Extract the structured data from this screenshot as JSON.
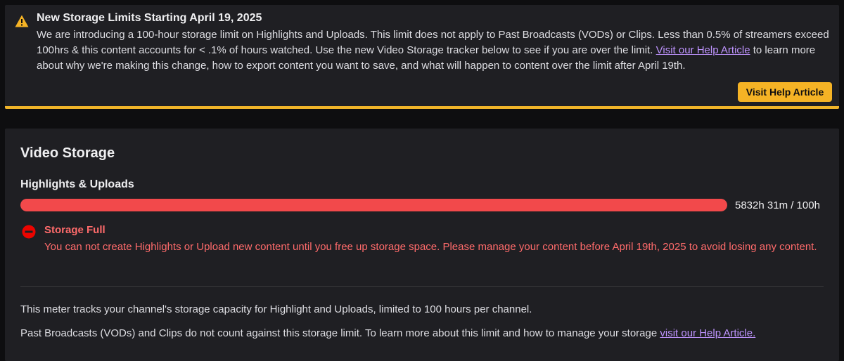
{
  "banner": {
    "title": "New Storage Limits Starting April 19, 2025",
    "body_before_link": "We are introducing a 100-hour storage limit on Highlights and Uploads. This limit does not apply to Past Broadcasts (VODs) or Clips. Less than 0.5% of streamers exceed 100hrs & this content accounts for < .1% of hours watched. Use the new Video Storage tracker below to see if you are over the limit. ",
    "link_text": "Visit our Help Article",
    "body_after_link": " to learn more about why we're making this change, how to export content you want to save, and what will happen to content over the limit after April 19th.",
    "button_label": "Visit Help Article",
    "accent_color": "#f5b325",
    "icon": "warning-triangle-icon"
  },
  "storage": {
    "title": "Video Storage",
    "section_title": "Highlights & Uploads",
    "usage_text": "5832h 31m / 100h",
    "progress_percent": 100,
    "progress_color": "#f2494b",
    "error_icon": "minus-circle-icon",
    "error_title": "Storage Full",
    "error_body": "You can not create Highlights or Upload new content until you free up storage space. Please manage your content before April 19th, 2025 to avoid losing any content.",
    "info_line1": "This meter tracks your channel's storage capacity for Highlight and Uploads, limited to 100 hours per channel.",
    "info_line2_before_link": "Past Broadcasts (VODs) and Clips do not count against this storage limit. To learn more about this limit and how to manage your storage ",
    "info_line2_link": "visit our Help Article."
  }
}
